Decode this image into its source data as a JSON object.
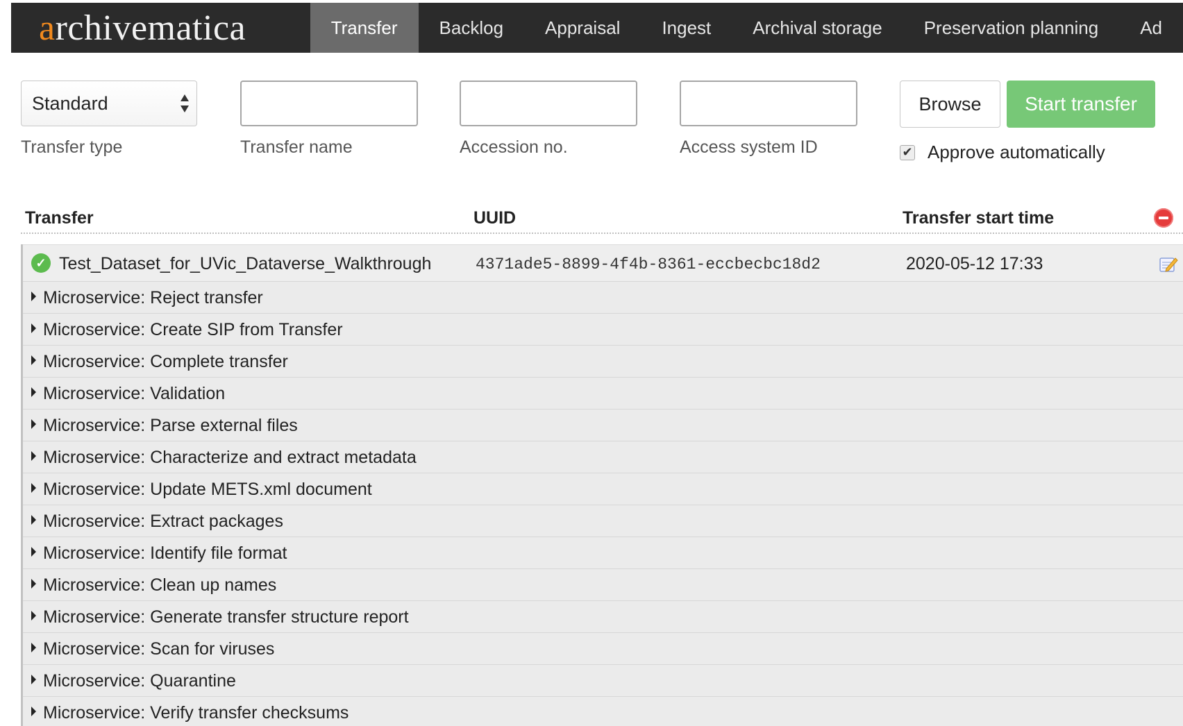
{
  "brand": {
    "first_letter": "a",
    "rest": "rchivematica"
  },
  "nav": {
    "items": [
      "Transfer",
      "Backlog",
      "Appraisal",
      "Ingest",
      "Archival storage",
      "Preservation planning",
      "Ad"
    ],
    "active": "Transfer"
  },
  "form": {
    "transfer_type": {
      "value": "Standard",
      "label": "Transfer type"
    },
    "transfer_name": {
      "value": "",
      "label": "Transfer name"
    },
    "accession_no": {
      "value": "",
      "label": "Accession no."
    },
    "access_system_id": {
      "value": "",
      "label": "Access system ID"
    },
    "browse_label": "Browse",
    "start_label": "Start transfer",
    "approve_label": "Approve automatically",
    "approve_checked": true
  },
  "table": {
    "headers": {
      "transfer": "Transfer",
      "uuid": "UUID",
      "start_time": "Transfer start time"
    },
    "transfer": {
      "name": "Test_Dataset_for_UVic_Dataverse_Walkthrough",
      "uuid": "4371ade5-8899-4f4b-8361-eccbecbc18d2",
      "start_time": "2020-05-12 17:33",
      "status": "complete"
    },
    "microservices": [
      "Microservice: Reject transfer",
      "Microservice: Create SIP from Transfer",
      "Microservice: Complete transfer",
      "Microservice: Validation",
      "Microservice: Parse external files",
      "Microservice: Characterize and extract metadata",
      "Microservice: Update METS.xml document",
      "Microservice: Extract packages",
      "Microservice: Identify file format",
      "Microservice: Clean up names",
      "Microservice: Generate transfer structure report",
      "Microservice: Scan for viruses",
      "Microservice: Quarantine",
      "Microservice: Verify transfer checksums"
    ]
  },
  "colors": {
    "navbar": "#2b2b2b",
    "brand_accent": "#f28a1e",
    "start_button": "#77c877",
    "remove_icon": "#e53b3b",
    "status_ok": "#5cbb4e"
  }
}
